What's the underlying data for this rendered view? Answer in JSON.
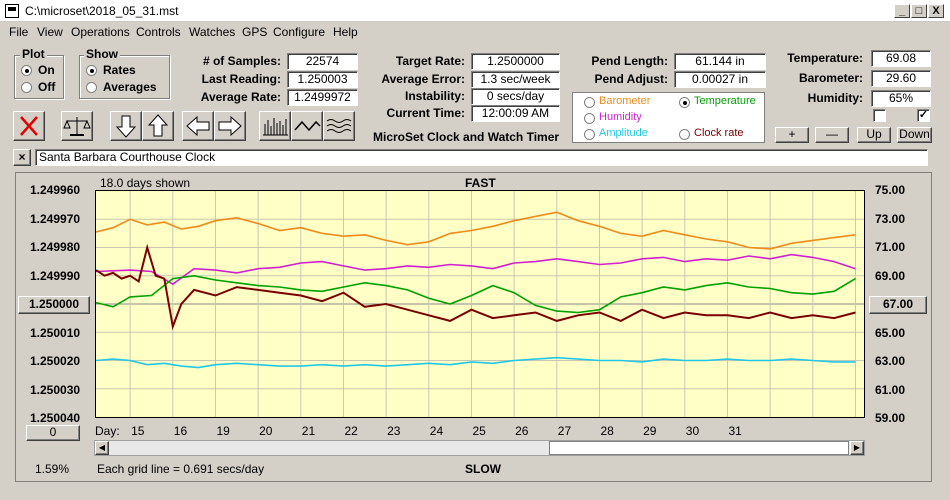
{
  "window": {
    "title": "C:\\microset\\2018_05_31.mst",
    "min": "_",
    "max": "□",
    "close": "X"
  },
  "menu": [
    "File",
    "View",
    "Operations",
    "Controls",
    "Watches",
    "GPS",
    "Configure",
    "Help"
  ],
  "plot_group": {
    "label": "Plot",
    "options": [
      {
        "label": "On",
        "selected": true
      },
      {
        "label": "Off",
        "selected": false
      }
    ]
  },
  "show_group": {
    "label": "Show",
    "options": [
      {
        "label": "Rates",
        "selected": true
      },
      {
        "label": "Averages",
        "selected": false
      }
    ]
  },
  "stats1": [
    {
      "label": "# of Samples:",
      "value": "22574"
    },
    {
      "label": "Last Reading:",
      "value": "1.250003"
    },
    {
      "label": "Average Rate:",
      "value": "1.2499972"
    }
  ],
  "stats2": [
    {
      "label": "Target Rate:",
      "value": "1.2500000"
    },
    {
      "label": "Average Error:",
      "value": "1.3 sec/week"
    },
    {
      "label": "Instability:",
      "value": "0 secs/day"
    },
    {
      "label": "Current Time:",
      "value": "12:00:09 AM"
    }
  ],
  "pend": [
    {
      "label": "Pend Length:",
      "value": "61.144 in"
    },
    {
      "label": "Pend Adjust:",
      "value": "0.00027 in"
    }
  ],
  "env": [
    {
      "label": "Temperature:",
      "value": "69.08"
    },
    {
      "label": "Barometer:",
      "value": "29.60"
    },
    {
      "label": "Humidity:",
      "value": "65%"
    }
  ],
  "series_select": [
    {
      "label": "Barometer",
      "color": "#f08a1a",
      "selected": false
    },
    {
      "label": "Temperature",
      "color": "#00a000",
      "selected": true
    },
    {
      "label": "Humidity",
      "color": "#d020d0",
      "selected": false
    },
    {
      "label": "Amplitude",
      "color": "#20c8e8",
      "selected": false
    },
    {
      "label": "Clock rate",
      "color": "#7a0000",
      "selected": false
    }
  ],
  "env_buttons": [
    "+",
    "—",
    "Up",
    "Down"
  ],
  "app_caption": "MicroSet Clock and Watch Timer",
  "watch_name": "Santa Barbara Courthouse Clock",
  "close_watch": "×",
  "toolbar_icons": [
    "cancel-icon",
    "scale-icon",
    "arrow-down-icon",
    "arrow-up-icon",
    "arrow-left-icon",
    "arrow-right-icon",
    "bars-icon",
    "wave-icon",
    "multiwave-icon"
  ],
  "chart_header": {
    "days_shown": "18.0 days shown",
    "fast": "FAST",
    "slow": "SLOW",
    "grid_note": "Each grid line = 0.691 secs/day",
    "percent": "1.59%",
    "day_prefix": "Day:",
    "center_left": "1.250000",
    "center_right": "67.00",
    "bottom_left": "0"
  },
  "chart_data": {
    "type": "line",
    "left_axis": {
      "ticks": [
        "1.249960",
        "1.249970",
        "1.249980",
        "1.249990",
        "1.250000",
        "1.250010",
        "1.250020",
        "1.250030",
        "1.250040"
      ]
    },
    "right_axis": {
      "ticks": [
        "75.00",
        "73.00",
        "71.00",
        "69.00",
        "67.00",
        "65.00",
        "63.00",
        "61.00",
        "59.00"
      ]
    },
    "days": [
      "15",
      "16",
      "19",
      "20",
      "21",
      "22",
      "23",
      "24",
      "25",
      "26",
      "27",
      "28",
      "29",
      "30",
      "31"
    ],
    "x_range": [
      14.2,
      32.2
    ],
    "right_range": [
      59,
      75
    ],
    "series": [
      {
        "name": "Barometer",
        "color": "#f08a1a",
        "x": [
          14.2,
          14.6,
          15,
          15.4,
          15.8,
          16.2,
          16.6,
          17,
          17.5,
          18,
          18.5,
          19,
          19.5,
          20,
          20.5,
          21,
          21.5,
          22,
          22.5,
          23,
          23.5,
          24,
          24.5,
          25,
          25.5,
          26,
          26.5,
          27,
          27.5,
          28,
          28.5,
          29,
          29.5,
          30,
          30.5,
          31,
          31.5,
          32
        ],
        "y": [
          72.1,
          72.4,
          73.0,
          72.6,
          72.8,
          72.3,
          72.5,
          72.9,
          73.1,
          72.7,
          72.2,
          72.4,
          72.0,
          71.8,
          71.9,
          71.5,
          71.2,
          71.4,
          72.0,
          72.2,
          72.5,
          72.9,
          73.2,
          73.5,
          72.9,
          72.5,
          72.0,
          71.8,
          72.2,
          71.9,
          71.6,
          71.4,
          71.0,
          70.9,
          71.3,
          71.5,
          71.7,
          71.9
        ]
      },
      {
        "name": "Humidity",
        "color": "#d020d0",
        "x": [
          14.2,
          15,
          15.5,
          16,
          16.5,
          17,
          17.5,
          18,
          18.5,
          19,
          19.5,
          20,
          20.5,
          21,
          21.5,
          22,
          22.5,
          23,
          23.5,
          24,
          24.5,
          25,
          25.5,
          26,
          26.5,
          27,
          27.5,
          28,
          28.5,
          29,
          29.5,
          30,
          30.5,
          31,
          31.5,
          32
        ],
        "y": [
          69.3,
          69.4,
          69.3,
          68.4,
          69.5,
          69.4,
          69.2,
          69.5,
          69.6,
          69.9,
          70.0,
          69.7,
          69.4,
          69.5,
          69.7,
          69.6,
          69.8,
          69.7,
          69.5,
          69.9,
          70.0,
          70.2,
          70.0,
          69.8,
          69.9,
          70.2,
          70.3,
          70.0,
          70.2,
          70.1,
          70.4,
          70.2,
          70.5,
          70.3,
          70.0,
          69.5
        ]
      },
      {
        "name": "Temperature",
        "color": "#00a000",
        "x": [
          14.2,
          14.6,
          15,
          15.5,
          16,
          16.5,
          17,
          17.5,
          18,
          18.5,
          19,
          19.5,
          20,
          20.5,
          21,
          21.5,
          22,
          22.5,
          23,
          23.5,
          24,
          24.5,
          25,
          25.5,
          26,
          26.5,
          27,
          27.5,
          28,
          28.5,
          29,
          29.5,
          30,
          30.5,
          31,
          31.5,
          32
        ],
        "y": [
          67.1,
          66.8,
          67.5,
          67.6,
          68.8,
          69.0,
          68.7,
          68.5,
          68.3,
          68.2,
          68.0,
          67.9,
          68.2,
          68.5,
          68.3,
          68.0,
          67.4,
          67.0,
          67.6,
          68.3,
          67.8,
          66.9,
          66.5,
          66.4,
          66.6,
          67.5,
          67.8,
          68.2,
          68.0,
          68.3,
          68.5,
          68.2,
          68.1,
          67.8,
          67.7,
          67.9,
          68.8
        ]
      },
      {
        "name": "Amplitude",
        "color": "#20c8e8",
        "x": [
          14.2,
          14.6,
          15,
          15.4,
          15.8,
          16.2,
          16.6,
          17,
          17.5,
          18,
          18.5,
          19,
          19.5,
          20,
          20.5,
          21,
          21.5,
          22,
          22.5,
          23,
          23.5,
          24,
          24.5,
          25,
          25.5,
          26,
          26.5,
          27,
          27.5,
          28,
          28.5,
          29,
          29.5,
          30,
          30.5,
          31,
          31.5,
          32
        ],
        "y": [
          63.0,
          63.1,
          63.0,
          62.7,
          62.8,
          62.6,
          62.5,
          62.7,
          62.8,
          62.7,
          62.6,
          62.6,
          62.7,
          62.6,
          62.7,
          62.6,
          62.7,
          62.8,
          62.7,
          62.9,
          62.8,
          63.0,
          63.1,
          63.2,
          63.1,
          63.0,
          63.0,
          62.9,
          63.1,
          63.0,
          63.0,
          63.1,
          63.0,
          63.0,
          63.1,
          63.0,
          62.9,
          62.9
        ]
      },
      {
        "name": "Clock rate",
        "color": "#7a0000",
        "x": [
          14.2,
          14.4,
          14.6,
          14.8,
          15,
          15.2,
          15.4,
          15.6,
          15.8,
          16,
          16.2,
          16.5,
          17,
          17.5,
          18,
          18.5,
          19,
          19.5,
          20,
          20.5,
          21,
          21.5,
          22,
          22.5,
          23,
          23.5,
          24,
          24.5,
          25,
          25.5,
          26,
          26.5,
          27,
          27.5,
          28,
          28.5,
          29,
          29.5,
          30,
          30.5,
          31,
          31.5,
          32
        ],
        "y": [
          1.249988,
          1.24999,
          1.249989,
          1.249991,
          1.24999,
          1.249992,
          1.24998,
          1.24999,
          1.249991,
          1.250008,
          1.25,
          1.249995,
          1.249997,
          1.249994,
          1.249995,
          1.249996,
          1.249997,
          1.249999,
          1.249996,
          1.250001,
          1.25,
          1.250002,
          1.250004,
          1.250006,
          1.250002,
          1.250005,
          1.250004,
          1.250003,
          1.250006,
          1.250004,
          1.250003,
          1.250006,
          1.250002,
          1.250005,
          1.250003,
          1.250004,
          1.250004,
          1.250005,
          1.250003,
          1.250005,
          1.250004,
          1.250005,
          1.250003
        ]
      }
    ],
    "left_range": [
      1.24996,
      1.25004
    ]
  }
}
